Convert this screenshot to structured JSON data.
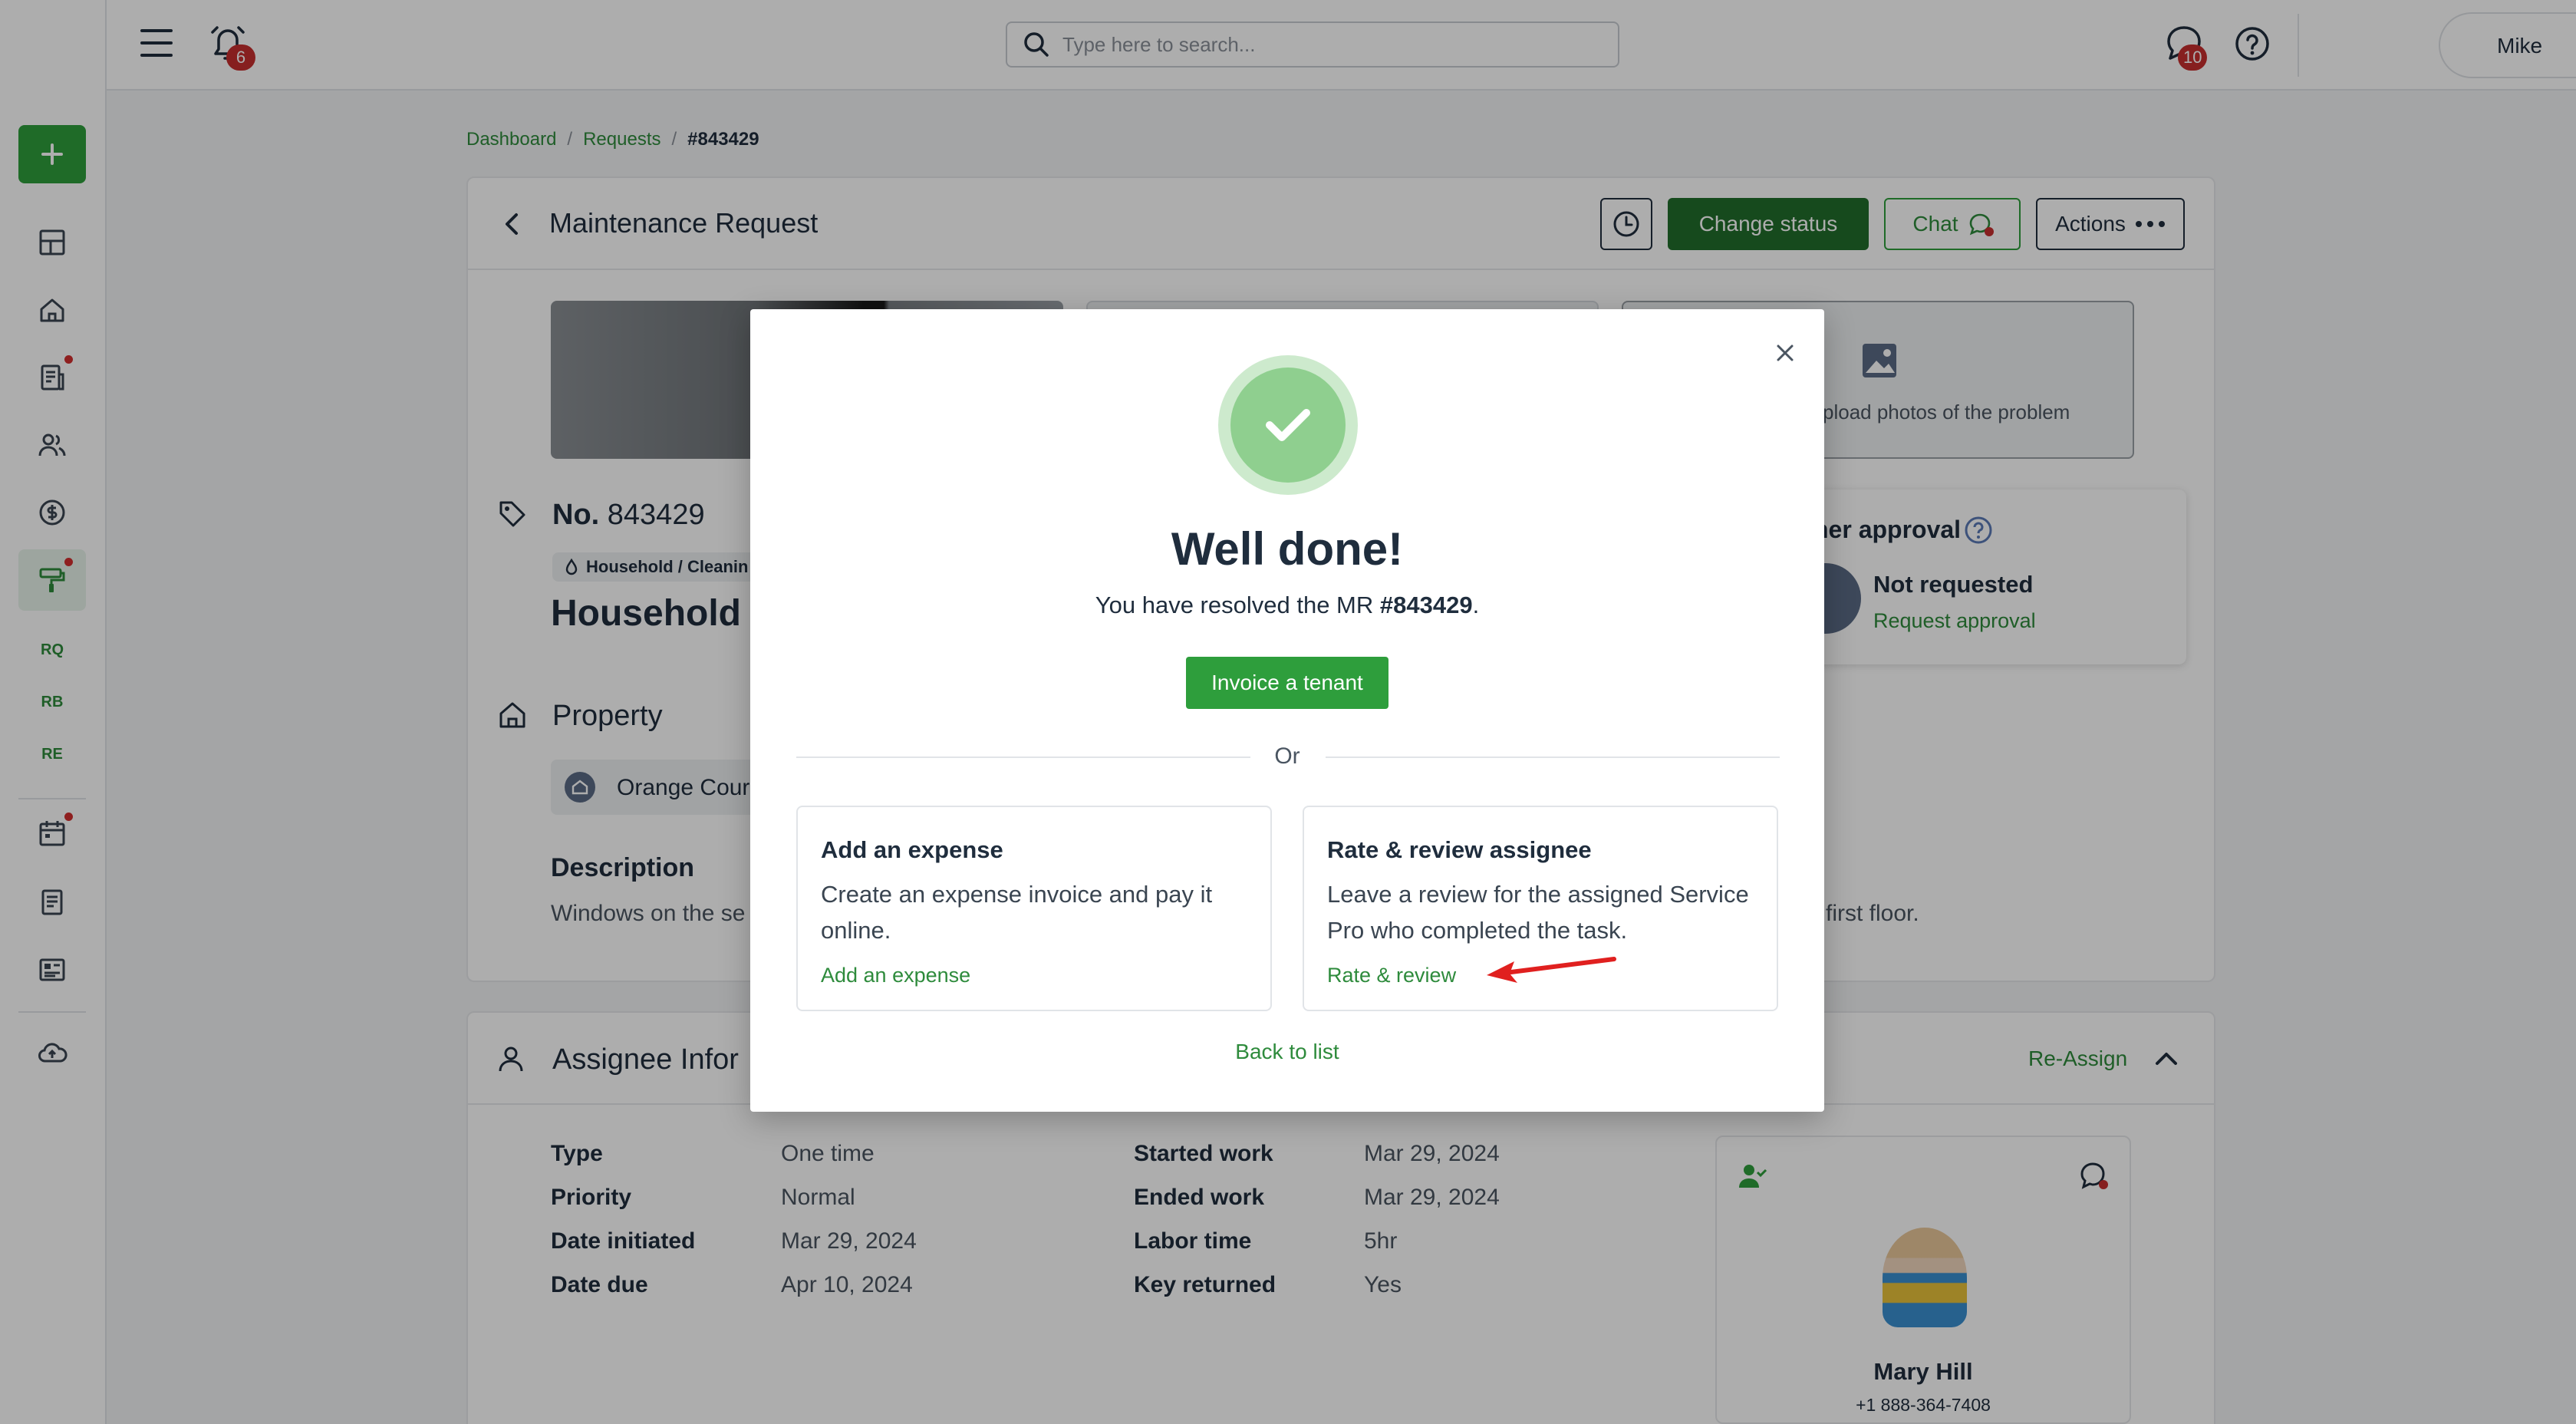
{
  "topbar": {
    "notification_count": "6",
    "search_placeholder": "Type here to search...",
    "chat_count": "10",
    "user_name": "Mike"
  },
  "sidebar": {
    "text_items": [
      "RQ",
      "RB",
      "RE"
    ]
  },
  "breadcrumb": {
    "items": [
      "Dashboard",
      "Requests",
      "#843429"
    ]
  },
  "header": {
    "title": "Maintenance Request",
    "change_status": "Change status",
    "chat": "Chat",
    "actions": "Actions"
  },
  "request": {
    "number_label": "No.",
    "number": "843429",
    "category_tag": "Household / Cleanin",
    "title": "Household",
    "property_heading": "Property",
    "property_name": "Orange Cour",
    "description_heading": "Description",
    "description_start": "Windows on the se",
    "description_end": "first floor.",
    "upload_text": "pload photos of the problem"
  },
  "approval": {
    "heading": "ner approval",
    "status": "Not requested",
    "link": "Request approval"
  },
  "assignee": {
    "heading": "Assignee Infor",
    "reassign": "Re-Assign",
    "fields_left": [
      {
        "k": "Type",
        "v": "One time"
      },
      {
        "k": "Priority",
        "v": "Normal"
      },
      {
        "k": "Date initiated",
        "v": "Mar 29, 2024"
      },
      {
        "k": "Date due",
        "v": "Apr 10, 2024"
      }
    ],
    "fields_right": [
      {
        "k": "Started work",
        "v": "Mar 29, 2024"
      },
      {
        "k": "Ended work",
        "v": "Mar 29, 2024"
      },
      {
        "k": "Labor time",
        "v": "5hr"
      },
      {
        "k": "Key returned",
        "v": "Yes"
      }
    ],
    "person_name": "Mary Hill",
    "person_phone": "+1 888-364-7408"
  },
  "modal": {
    "title": "Well done!",
    "subtitle_prefix": "You have resolved the MR ",
    "subtitle_id": "#843429",
    "subtitle_suffix": ".",
    "invoice_button": "Invoice a tenant",
    "or": "Or",
    "option_expense": {
      "heading": "Add an expense",
      "description": "Create an expense invoice and pay it online.",
      "link": "Add an expense"
    },
    "option_review": {
      "heading": "Rate & review assignee",
      "description": "Leave a review for the assigned Service Pro who completed the task.",
      "link": "Rate & review"
    },
    "back": "Back to list"
  },
  "colors": {
    "brand_green": "#2e9e3c",
    "dark_green": "#216e2c",
    "badge_red": "#c62f2f",
    "annotation_arrow": "#e0201f"
  }
}
